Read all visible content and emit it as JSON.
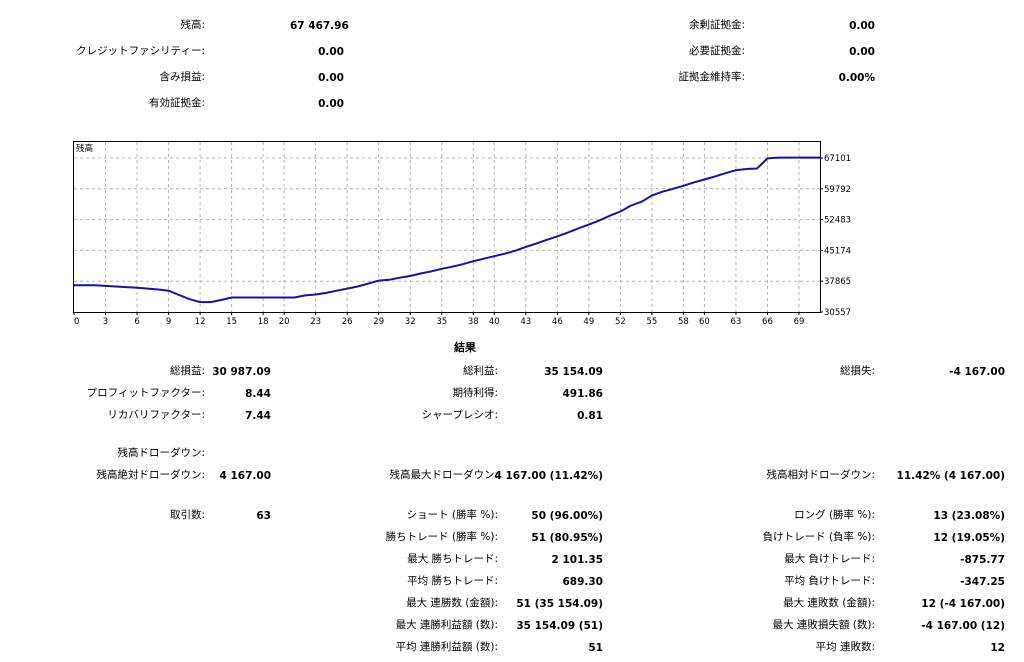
{
  "summary": {
    "balance_label": "残高:",
    "balance_value": "67 467.96",
    "credit_label": "クレジットファシリティー:",
    "credit_value": "0.00",
    "floating_label": "含み損益:",
    "floating_value": "0.00",
    "equity_label": "有効証拠金:",
    "equity_value": "0.00",
    "free_margin_label": "余剰証拠金:",
    "free_margin_value": "0.00",
    "margin_label": "必要証拠金:",
    "margin_value": "0.00",
    "margin_level_label": "証拠金維持率:",
    "margin_level_value": "0.00%"
  },
  "chart_data": {
    "type": "line",
    "title": "残高",
    "x_ticks": [
      "0",
      "3",
      "6",
      "9",
      "12",
      "15",
      "18",
      "20",
      "23",
      "26",
      "29",
      "32",
      "35",
      "38",
      "40",
      "43",
      "46",
      "49",
      "52",
      "55",
      "58",
      "60",
      "63",
      "66",
      "69"
    ],
    "y_ticks": [
      "67101",
      "59792",
      "52483",
      "45174",
      "37865",
      "30557"
    ],
    "ylim": [
      30557,
      67101
    ],
    "xlim": [
      0,
      71
    ],
    "grid": true,
    "line_color": "#1414a0",
    "x": [
      0,
      2,
      4,
      6,
      8,
      9,
      10,
      11,
      12,
      13,
      14,
      15,
      16,
      17,
      18,
      19,
      20,
      21,
      22,
      23,
      24,
      25,
      26,
      27,
      28,
      29,
      30,
      31,
      32,
      33,
      34,
      35,
      36,
      37,
      38,
      39,
      40,
      41,
      42,
      43,
      44,
      45,
      46,
      47,
      48,
      49,
      50,
      51,
      52,
      53,
      54,
      55,
      56,
      57,
      58,
      59,
      60,
      61,
      62,
      63,
      64,
      65,
      66,
      67,
      68,
      69,
      70,
      71
    ],
    "y": [
      36900,
      36900,
      36600,
      36300,
      35900,
      35600,
      34600,
      33600,
      32900,
      32900,
      33400,
      34000,
      34000,
      34000,
      34000,
      34000,
      34000,
      34000,
      34500,
      34700,
      35100,
      35600,
      36100,
      36600,
      37300,
      38000,
      38200,
      38700,
      39100,
      39700,
      40200,
      40800,
      41300,
      41900,
      42600,
      43200,
      43800,
      44400,
      45100,
      46000,
      46800,
      47700,
      48500,
      49400,
      50400,
      51300,
      52300,
      53400,
      54400,
      55800,
      56700,
      58200,
      59100,
      59800,
      60500,
      61300,
      62000,
      62700,
      63500,
      64200,
      64500,
      64600,
      67000,
      67200,
      67200,
      67200,
      67200,
      67200
    ]
  },
  "results": {
    "title": "結果",
    "gross_total_label": "総損益:",
    "gross_total_value": "30 987.09",
    "gross_profit_label": "総利益:",
    "gross_profit_value": "35 154.09",
    "gross_loss_label": "総損失:",
    "gross_loss_value": "-4 167.00",
    "profit_factor_label": "プロフィットファクター:",
    "profit_factor_value": "8.44",
    "expected_payoff_label": "期待利得:",
    "expected_payoff_value": "491.86",
    "recovery_factor_label": "リカバリファクター:",
    "recovery_factor_value": "7.44",
    "sharpe_label": "シャープレシオ:",
    "sharpe_value": "0.81",
    "balance_dd_label": "残高ドローダウン:",
    "abs_dd_label": "残高絶対ドローダウン:",
    "abs_dd_value": "4 167.00",
    "max_dd_label": "残高最大ドローダウン:",
    "max_dd_value": "4 167.00 (11.42%)",
    "rel_dd_label": "残高相対ドローダウン:",
    "rel_dd_value": "11.42% (4 167.00)",
    "trades_label": "取引数:",
    "trades_value": "63",
    "short_label": "ショート (勝率 %):",
    "short_value": "50 (96.00%)",
    "long_label": "ロング (勝率 %):",
    "long_value": "13 (23.08%)",
    "win_trades_label": "勝ちトレード (勝率 %):",
    "win_trades_value": "51 (80.95%)",
    "loss_trades_label": "負けトレード (負率 %):",
    "loss_trades_value": "12 (19.05%)",
    "max_win_label": "最大 勝ちトレード:",
    "max_win_value": "2 101.35",
    "max_loss_label": "最大 負けトレード:",
    "max_loss_value": "-875.77",
    "avg_win_label": "平均 勝ちトレード:",
    "avg_win_value": "689.30",
    "avg_loss_label": "平均 負けトレード:",
    "avg_loss_value": "-347.25",
    "max_cons_wins_label": "最大 連勝数 (金額):",
    "max_cons_wins_value": "51 (35 154.09)",
    "max_cons_losses_label": "最大 連敗数 (金額):",
    "max_cons_losses_value": "12 (-4 167.00)",
    "max_cons_profit_label": "最大 連勝利益額 (数):",
    "max_cons_profit_value": "35 154.09 (51)",
    "max_cons_loss_amt_label": "最大 連敗損失額 (数):",
    "max_cons_loss_amt_value": "-4 167.00 (12)",
    "avg_cons_wins_label": "平均 連勝利益額 (数):",
    "avg_cons_wins_value": "51",
    "avg_cons_losses_label": "平均 連敗数:",
    "avg_cons_losses_value": "12"
  }
}
